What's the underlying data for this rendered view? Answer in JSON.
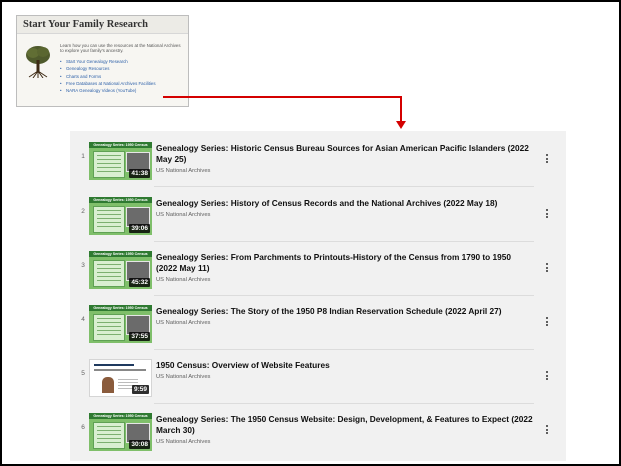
{
  "family_box": {
    "title": "Start Your Family Research",
    "intro": "Learn how you can use the resources at the National Archives to explore your family's ancestry.",
    "links": [
      "Start Your Genealogy Research",
      "Genealogy Resources",
      "Charts and Forms",
      "Free Databases at National Archives Facilities",
      "NARA Genealogy Videos (YouTube)"
    ]
  },
  "arrow": {
    "color": "#d40000"
  },
  "playlist": {
    "items": [
      {
        "index": "1",
        "title": "Genealogy Series: Historic Census Bureau Sources for Asian American Pacific Islanders (2022 May 25)",
        "channel": "US National Archives",
        "duration": "41:38",
        "thumb_band": "Genealogy Series: 1950 Census",
        "thumb_style": "green"
      },
      {
        "index": "2",
        "title": "Genealogy Series: History of Census Records and the National Archives (2022 May 18)",
        "channel": "US National Archives",
        "duration": "39:06",
        "thumb_band": "Genealogy Series: 1950 Census",
        "thumb_style": "green"
      },
      {
        "index": "3",
        "title": "Genealogy Series: From Parchments to Printouts-History of the Census from 1790 to 1950 (2022 May 11)",
        "channel": "US National Archives",
        "duration": "45:32",
        "thumb_band": "Genealogy Series: 1950 Census",
        "thumb_style": "green"
      },
      {
        "index": "4",
        "title": "Genealogy Series: The Story of the 1950 P8 Indian Reservation Schedule (2022 April 27)",
        "channel": "US National Archives",
        "duration": "37:55",
        "thumb_band": "Genealogy Series: 1950 Census",
        "thumb_style": "green"
      },
      {
        "index": "5",
        "title": "1950 Census: Overview of Website Features",
        "channel": "US National Archives",
        "duration": "9:59",
        "thumb_band": "The 1950 Census Website",
        "thumb_style": "white"
      },
      {
        "index": "6",
        "title": "Genealogy Series: The 1950 Census Website: Design, Development, & Features to Expect (2022 March 30)",
        "channel": "US National Archives",
        "duration": "30:08",
        "thumb_band": "Genealogy Series: 1950 Census",
        "thumb_style": "green"
      }
    ]
  }
}
